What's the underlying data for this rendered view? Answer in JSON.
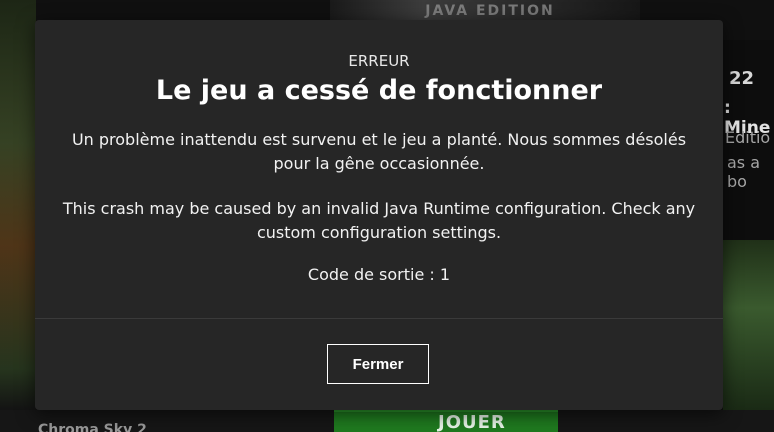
{
  "background": {
    "top_logo_text": "JAVA EDITION",
    "right_panel": {
      "title_fragment": "22",
      "subtitle_fragment": ": Mine",
      "edition_fragment": "Editio",
      "line_fragment": "as a bo"
    },
    "bottom_left_label": "Chroma Sky 2",
    "play_button_label": "JOUER"
  },
  "dialog": {
    "label": "ERREUR",
    "title": "Le jeu a cessé de fonctionner",
    "message_line_1": "Un problème inattendu est survenu et le jeu a planté. Nous sommes désolés pour la gêne occasionnée.",
    "message_line_2": "This crash may be caused by an invalid Java Runtime configuration. Check any custom configuration settings.",
    "exit_code": "Code de sortie : 1",
    "close_button_label": "Fermer"
  },
  "colors": {
    "dialog_background": "#262626",
    "page_background": "#101010",
    "button_border": "#ffffff",
    "play_button": "#1f7a1f"
  }
}
